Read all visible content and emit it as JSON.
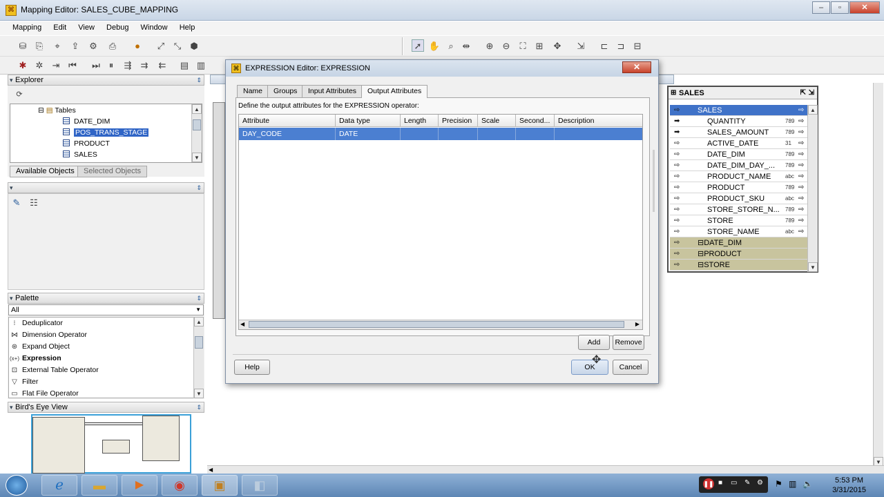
{
  "window": {
    "title": "Mapping Editor: SALES_CUBE_MAPPING",
    "min": "–",
    "max": "▫",
    "close": "✕"
  },
  "menu": [
    "Mapping",
    "Edit",
    "View",
    "Debug",
    "Window",
    "Help"
  ],
  "explorer": {
    "title": "Explorer",
    "tree": {
      "folder": "Tables",
      "items": [
        "DATE_DIM",
        "POS_TRANS_STAGE",
        "PRODUCT",
        "SALES"
      ]
    },
    "tabs": [
      "Available Objects",
      "Selected Objects"
    ]
  },
  "palette": {
    "title": "Palette",
    "filter": "All",
    "items": [
      "Deduplicator",
      "Dimension Operator",
      "Expand Object",
      "Expression",
      "External Table Operator",
      "Filter",
      "Flat File Operator"
    ]
  },
  "birds_eye": {
    "title": "Bird's Eye View"
  },
  "sales_operator": {
    "title": "SALES",
    "header": "SALES",
    "rows": [
      {
        "name": "QUANTITY",
        "type": "789"
      },
      {
        "name": "SALES_AMOUNT",
        "type": "789"
      },
      {
        "name": "ACTIVE_DATE",
        "type": "31"
      },
      {
        "name": "DATE_DIM",
        "type": "789"
      },
      {
        "name": "DATE_DIM_DAY_...",
        "type": "789"
      },
      {
        "name": "PRODUCT_NAME",
        "type": "abc"
      },
      {
        "name": "PRODUCT",
        "type": "789"
      },
      {
        "name": "PRODUCT_SKU",
        "type": "abc"
      },
      {
        "name": "STORE_STORE_N...",
        "type": "789"
      },
      {
        "name": "STORE",
        "type": "789"
      },
      {
        "name": "STORE_NAME",
        "type": "abc"
      }
    ],
    "groups": [
      "DATE_DIM",
      "PRODUCT",
      "STORE"
    ]
  },
  "dialog": {
    "title": "EXPRESSION Editor: EXPRESSION",
    "close": "✕",
    "tabs": [
      "Name",
      "Groups",
      "Input Attributes",
      "Output Attributes"
    ],
    "description": "Define the output attributes for the EXPRESSION operator:",
    "columns": [
      "Attribute",
      "Data type",
      "Length",
      "Precision",
      "Scale",
      "Second...",
      "Description"
    ],
    "rows": [
      [
        "DAY_CODE",
        "DATE",
        "",
        "",
        "",
        "",
        ""
      ]
    ],
    "buttons": {
      "add": "Add",
      "remove": "Remove",
      "help": "Help",
      "ok": "OK",
      "cancel": "Cancel"
    }
  },
  "clock": {
    "time": "5:53 PM",
    "date": "3/31/2015"
  }
}
